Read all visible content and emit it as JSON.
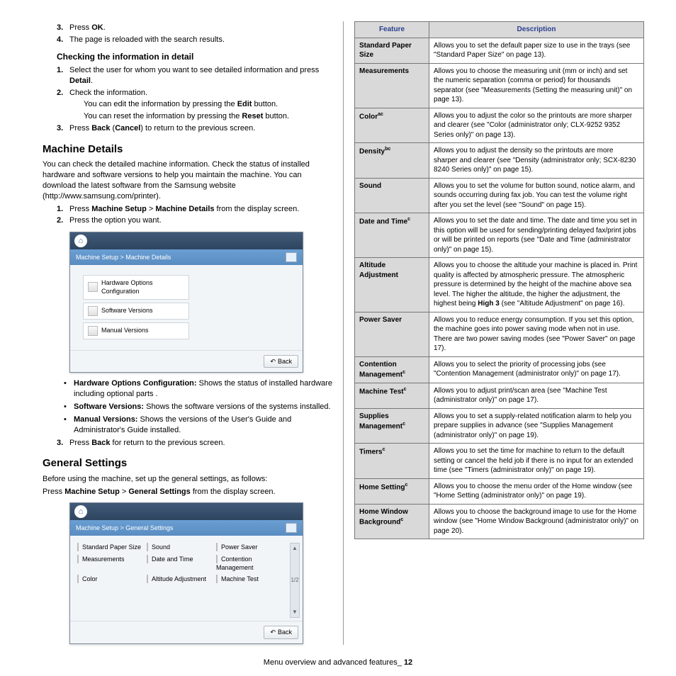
{
  "left": {
    "steps_top": [
      {
        "n": "3.",
        "t": "Press <b>OK</b>."
      },
      {
        "n": "4.",
        "t": "The page is reloaded with the search results."
      }
    ],
    "check_heading": "Checking the information in detail",
    "check_steps": [
      {
        "n": "1.",
        "t": "Select the user for whom you want to see detailed information and press <b>Detail</b>."
      },
      {
        "n": "2.",
        "t": "Check the information."
      },
      {
        "n": "3.",
        "t": "Press <b>Back</b> (<b>Cancel</b>) to return to the previous screen."
      }
    ],
    "check_sub": [
      "You can edit the information by pressing the <b>Edit</b> button.",
      "You can reset the information by pressing the <b>Reset</b> button."
    ],
    "md_heading": "Machine Details",
    "md_para": "You can check the detailed machine information. Check the status of installed hardware and software versions to help you maintain the machine. You can download the latest software from the Samsung website (http://www.samsung.com/printer).",
    "md_steps": [
      {
        "n": "1.",
        "t": "Press <b>Machine Setup</b> > <b>Machine Details</b> from the display screen."
      },
      {
        "n": "2.",
        "t": "Press the option you want."
      }
    ],
    "ss1": {
      "crumb": "Machine Setup > Machine Details",
      "items": [
        "Hardware Options Configuration",
        "Software Versions",
        "Manual Versions"
      ],
      "back": "Back"
    },
    "md_bullets": [
      "<b>Hardware Options Configuration:</b>  Shows the status of installed hardware including optional parts .",
      "<b>Software Versions:</b>  Shows the software versions of the systems installed.",
      "<b>Manual Versions:</b>  Shows the versions of the User's Guide and Administrator's Guide installed."
    ],
    "md_step3": {
      "n": "3.",
      "t": "Press <b>Back</b> for return to the previous screen."
    },
    "gs_heading": "General Settings",
    "gs_para1": "Before using the machine, set up the general settings, as follows:",
    "gs_para2": "Press <b>Machine Setup</b> > <b>General Settings</b> from the display screen.",
    "ss2": {
      "crumb": "Machine Setup > General Settings",
      "items": [
        "Standard Paper Size",
        "Sound",
        "Power Saver",
        "Measurements",
        "Date and Time",
        "Contention Management",
        "Color",
        "Altitude Adjustment",
        "Machine Test"
      ],
      "page": "1/2",
      "back": "Back"
    }
  },
  "table": {
    "h1": "Feature",
    "h2": "Description",
    "rows": [
      {
        "f": "Standard Paper Size",
        "d": "Allows you to set the default paper size to use in the trays (see \"Standard Paper Size\" on page 13)."
      },
      {
        "f": "Measurements",
        "d": "Allows you to choose the measuring unit (mm or inch) and set the numeric separation (comma or period) for thousands separator (see \"Measurements (Setting the measuring unit)\" on page 13)."
      },
      {
        "f": "Color<sup>ac</sup>",
        "d": "Allows you to adjust the color so the printouts are more sharper and clearer (see \"Color (administrator only; CLX-9252 9352 Series only)\" on page 13)."
      },
      {
        "f": "Density<sup>bc</sup>",
        "d": "Allows you to adjust the density so the printouts are more sharper and clearer (see \"Density (administrator only; SCX-8230 8240 Series only)\" on page 15)."
      },
      {
        "f": "Sound",
        "d": "Allows you to set the volume for button sound, notice alarm, and sounds occurring during fax job. You can test the volume right after you set the level (see \"Sound\" on page 15)."
      },
      {
        "f": "Date and Time<sup>c</sup>",
        "d": "Allows you to set the date and time. The date and time you set in this option will be used for sending/printing delayed fax/print jobs or will be printed on reports (see \"Date and Time (administrator only)\" on page 15)."
      },
      {
        "f": "Altitude Adjustment",
        "d": "Allows you to choose the altitude your machine is placed in. Print quality is affected by atmospheric pressure. The atmospheric pressure is determined by the height of the machine above sea level. The higher the altitude, the higher the adjustment, the highest being <b>High 3</b> (see \"Altitude Adjustment\" on page 16)."
      },
      {
        "f": "Power Saver",
        "d": "Allows you to reduce energy consumption. If you set this option, the machine goes into power saving mode when not in use.<br>There are two power saving modes (see \"Power Saver\" on page 17)."
      },
      {
        "f": "Contention Management<sup>c</sup>",
        "d": "Allows you to select the priority of processing jobs (see \"Contention Management (administrator only)\" on page 17)."
      },
      {
        "f": "Machine Test<sup>c</sup>",
        "d": "Allows you to adjust print/scan area (see \"Machine Test (administrator only)\" on page 17)."
      },
      {
        "f": "Supplies Management<sup>c</sup>",
        "d": "Allows you to set a supply-related notification alarm to help you prepare supplies in advance (see \"Supplies Management (administrator only)\" on page 19)."
      },
      {
        "f": "Timers<sup>c</sup>",
        "d": "Allows you to set the time for machine to return to the default setting or cancel the held job if there is no input for an extended time (see \"Timers (administrator only)\" on page 19)."
      },
      {
        "f": "Home Setting<sup>c</sup>",
        "d": "Allows you to choose the menu order of the Home window (see \"Home Setting (administrator only)\" on page 19)."
      },
      {
        "f": "Home Window Background<sup>c</sup>",
        "d": "Allows you to choose the background image to use for the Home window (see \"Home Window Background (administrator only)\" on page 20)."
      }
    ]
  },
  "footer": "Menu overview and advanced features_",
  "pagenum": "12"
}
